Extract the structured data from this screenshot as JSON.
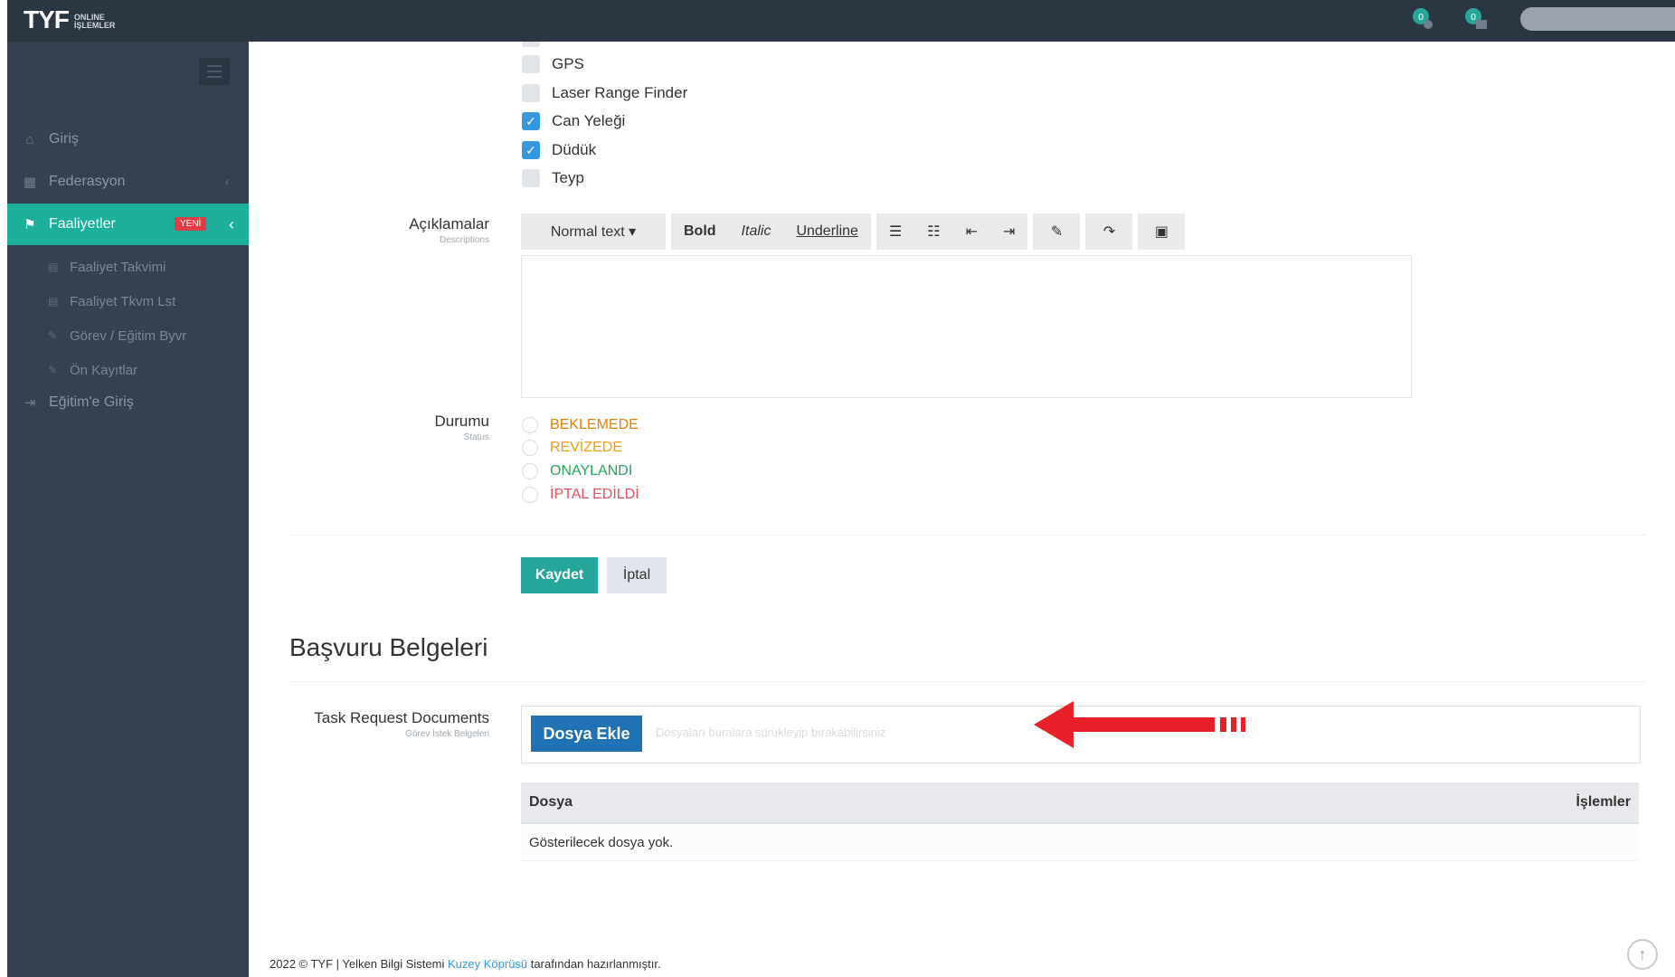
{
  "header": {
    "logo_main": "TYF",
    "logo_sub": "ONLINE İŞLEMLER",
    "notif_count": "0",
    "task_count": "0"
  },
  "sidebar": {
    "items": [
      {
        "label": "Giriş"
      },
      {
        "label": "Federasyon"
      },
      {
        "label": "Faaliyetler",
        "badge": "YENİ"
      },
      {
        "label": "Eğitim'e Giriş"
      }
    ],
    "subitems": [
      {
        "label": "Faaliyet Takvimi"
      },
      {
        "label": "Faaliyet Tkvm Lst"
      },
      {
        "label": "Görev / Eğitim Byvr"
      },
      {
        "label": "Ön Kayıtlar"
      }
    ]
  },
  "form": {
    "equipment": [
      {
        "label": "GPS",
        "checked": false
      },
      {
        "label": "Laser Range Finder",
        "checked": false
      },
      {
        "label": "Can Yeleği",
        "checked": true
      },
      {
        "label": "Düdük",
        "checked": true
      },
      {
        "label": "Teyp",
        "checked": false
      }
    ],
    "descriptions_label": "Açıklamalar",
    "descriptions_sublabel": "Descriptions",
    "toolbar": {
      "normal_text": "Normal text ▾",
      "bold": "Bold",
      "italic": "Italic",
      "underline": "Underline"
    },
    "status_label": "Durumu",
    "status_sublabel": "Status",
    "statuses": [
      {
        "label": "BEKLEMEDE",
        "color": "#e87e04"
      },
      {
        "label": "REVİZEDE",
        "color": "#f39c12"
      },
      {
        "label": "ONAYLANDI",
        "color": "#26a65b"
      },
      {
        "label": "İPTAL EDİLDİ",
        "color": "#e7505a"
      }
    ],
    "save_label": "Kaydet",
    "cancel_label": "İptal"
  },
  "documents": {
    "section_title": "Başvuru Belgeleri",
    "field_label": "Task Request Documents",
    "field_sublabel": "Görev İstek Belgeleri",
    "upload_button": "Dosya Ekle",
    "upload_hint": "Dosyaları buralara sürükleyip bırakabilirsiniz",
    "table_header_file": "Dosya",
    "table_header_actions": "İşlemler",
    "empty_text": "Gösterilecek dosya yok."
  },
  "footer": {
    "prefix": "2022 © TYF | Yelken Bilgi Sistemi",
    "link": "Kuzey Köprüsü",
    "suffix": "tarafından hazırlanmıştır."
  },
  "colors": {
    "sidebar_bg": "#364150",
    "header_bg": "#2b3643",
    "active": "#1caf9a",
    "primary": "#2072b4",
    "arrow": "#e8202a"
  }
}
